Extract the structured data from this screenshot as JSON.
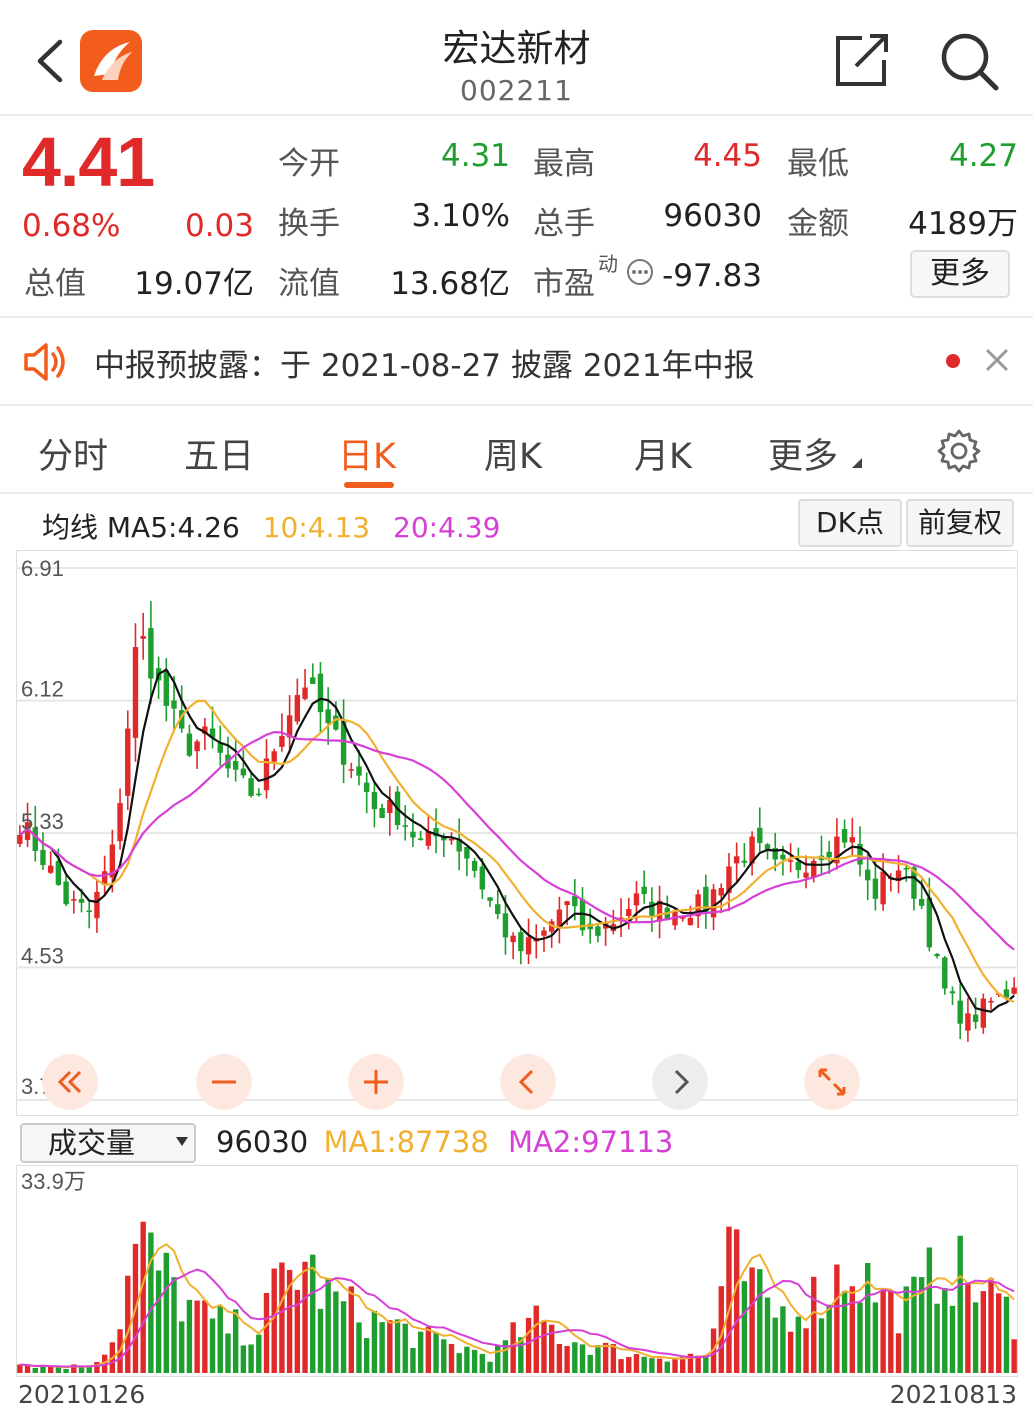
{
  "header": {
    "title": "宏达新材",
    "code": "002211"
  },
  "quote": {
    "price": "4.41",
    "change_pct": "0.68%",
    "change": "0.03",
    "open_label": "今开",
    "open": "4.31",
    "high_label": "最高",
    "high": "4.45",
    "low_label": "最低",
    "low": "4.27",
    "turnover_label": "换手",
    "turnover": "3.10%",
    "volume_label": "总手",
    "volume": "96030",
    "amount_label": "金额",
    "amount": "4189万",
    "mktcap_label": "总值",
    "mktcap": "19.07亿",
    "float_label": "流值",
    "float": "13.68亿",
    "pe_label": "市盈",
    "pe_sup": "动",
    "pe": "-97.83",
    "more_label": "更多"
  },
  "notice": {
    "text": "中报预披露：于 2021-08-27 披露 2021年中报"
  },
  "tabs": [
    "分时",
    "五日",
    "日K",
    "周K",
    "月K",
    "更多"
  ],
  "ma_bar": {
    "prefix": "均线 MA5:4.26",
    "ma10": "10:4.13",
    "ma20": "20:4.39",
    "dk_label": "DK点",
    "fq_label": "前复权"
  },
  "volume_bar": {
    "selector": "成交量",
    "value": "96030",
    "ma1": "MA1:87738",
    "ma2": "MA2:97113"
  },
  "colors": {
    "up": "#e02a2a",
    "down": "#1e9e2e",
    "accent": "#f25d1d",
    "ma5": "#111111",
    "ma10": "#f0b030",
    "ma20": "#d640d6"
  },
  "icons": [
    "back-arrow-icon",
    "app-logo-icon",
    "share-icon",
    "search-icon",
    "speaker-icon",
    "close-icon",
    "gear-icon",
    "rewind-icon",
    "zoom-out-icon",
    "zoom-in-icon",
    "chevron-left-icon",
    "chevron-right-icon",
    "fullscreen-icon",
    "dropdown-icon"
  ],
  "chart_data": {
    "type": "candlestick",
    "price_axis_labels": [
      "6.91",
      "6.12",
      "5.33",
      "4.53",
      "3.74"
    ],
    "ylim": [
      3.74,
      6.91
    ],
    "volume_axis_label": "33.9万",
    "volume_max": 339000,
    "x_start_label": "20210126",
    "x_end_label": "20210813",
    "waypoints_close": [
      5.4,
      5.18,
      4.92,
      4.85,
      5.25,
      6.55,
      6.15,
      5.85,
      5.9,
      5.65,
      5.55,
      5.95,
      6.25,
      5.95,
      5.75,
      5.48,
      5.45,
      5.25,
      5.35,
      5.18,
      4.88,
      4.62,
      4.7,
      4.92,
      4.72,
      4.8,
      4.93,
      4.88,
      4.88,
      4.9,
      5.15,
      5.25,
      5.1,
      5.15,
      5.25,
      5.33,
      4.95,
      5.15,
      4.95,
      4.4,
      4.2,
      4.32,
      4.41
    ],
    "waypoints_volume": [
      15000,
      12000,
      10000,
      16000,
      60000,
      230000,
      170000,
      120000,
      90000,
      80000,
      70000,
      160000,
      190000,
      130000,
      110000,
      90000,
      80000,
      60000,
      50000,
      40000,
      30000,
      70000,
      90000,
      60000,
      50000,
      40000,
      30000,
      30000,
      30000,
      30000,
      200000,
      140000,
      100000,
      120000,
      140000,
      190000,
      150000,
      110000,
      130000,
      200000,
      160000,
      130000,
      96030
    ]
  }
}
